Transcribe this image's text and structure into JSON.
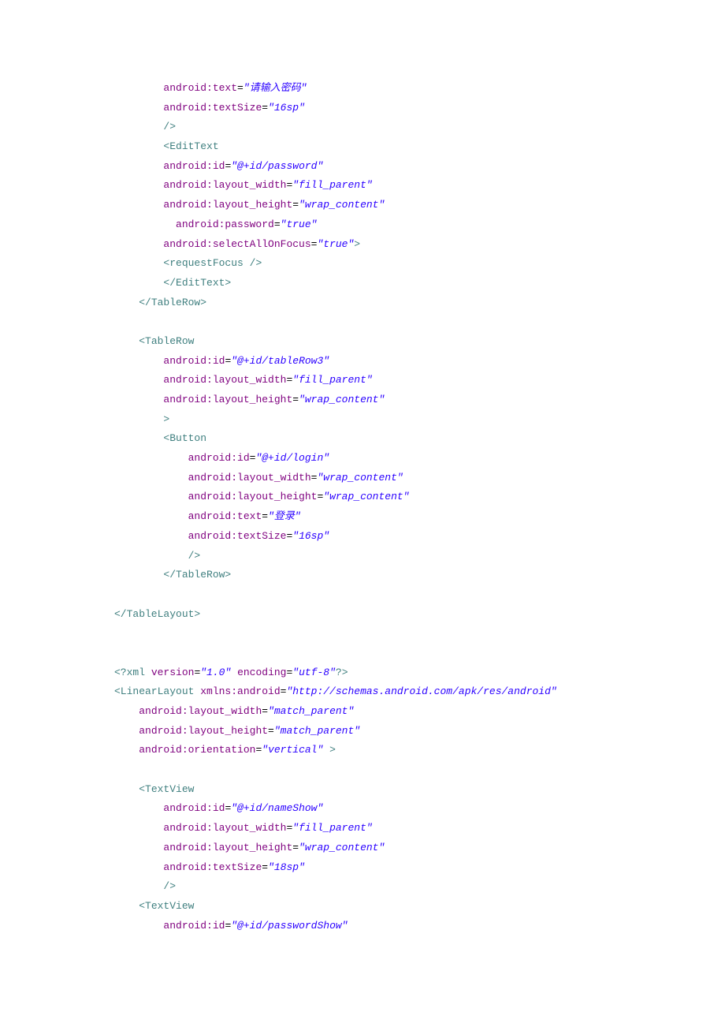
{
  "code": [
    {
      "indent": 2,
      "seg": [
        {
          "t": "attr",
          "v": "android:text"
        },
        {
          "t": "plain",
          "v": "="
        },
        {
          "t": "str",
          "v": "\"请输入密码\""
        }
      ]
    },
    {
      "indent": 2,
      "seg": [
        {
          "t": "attr",
          "v": "android:textSize"
        },
        {
          "t": "plain",
          "v": "="
        },
        {
          "t": "str",
          "v": "\"16sp\""
        }
      ]
    },
    {
      "indent": 2,
      "seg": [
        {
          "t": "tag",
          "v": "/>"
        }
      ]
    },
    {
      "indent": 2,
      "seg": [
        {
          "t": "tag",
          "v": "<EditText"
        }
      ]
    },
    {
      "indent": 2,
      "seg": [
        {
          "t": "attr",
          "v": "android:id"
        },
        {
          "t": "plain",
          "v": "="
        },
        {
          "t": "str",
          "v": "\"@+id/password\""
        }
      ]
    },
    {
      "indent": 2,
      "seg": [
        {
          "t": "attr",
          "v": "android:layout_width"
        },
        {
          "t": "plain",
          "v": "="
        },
        {
          "t": "str",
          "v": "\"fill_parent\""
        }
      ]
    },
    {
      "indent": 2,
      "seg": [
        {
          "t": "attr",
          "v": "android:layout_height"
        },
        {
          "t": "plain",
          "v": "="
        },
        {
          "t": "str",
          "v": "\"wrap_content\""
        }
      ]
    },
    {
      "indent": 2,
      "seg": [
        {
          "t": "plain",
          "v": "  "
        },
        {
          "t": "attr",
          "v": "android:password"
        },
        {
          "t": "plain",
          "v": "="
        },
        {
          "t": "str",
          "v": "\"true\""
        }
      ]
    },
    {
      "indent": 2,
      "seg": [
        {
          "t": "attr",
          "v": "android:selectAllOnFocus"
        },
        {
          "t": "plain",
          "v": "="
        },
        {
          "t": "str",
          "v": "\"true\""
        },
        {
          "t": "tag",
          "v": ">"
        }
      ]
    },
    {
      "indent": 2,
      "seg": [
        {
          "t": "tag",
          "v": "<requestFocus />"
        }
      ]
    },
    {
      "indent": 2,
      "seg": [
        {
          "t": "tag",
          "v": "</EditText>"
        }
      ]
    },
    {
      "indent": 1,
      "seg": [
        {
          "t": "tag",
          "v": "</TableRow>"
        }
      ]
    },
    {
      "indent": 0,
      "seg": [
        {
          "t": "plain",
          "v": ""
        }
      ]
    },
    {
      "indent": 1,
      "seg": [
        {
          "t": "tag",
          "v": "<TableRow"
        }
      ]
    },
    {
      "indent": 2,
      "seg": [
        {
          "t": "attr",
          "v": "android:id"
        },
        {
          "t": "plain",
          "v": "="
        },
        {
          "t": "str",
          "v": "\"@+id/tableRow3\""
        }
      ]
    },
    {
      "indent": 2,
      "seg": [
        {
          "t": "attr",
          "v": "android:layout_width"
        },
        {
          "t": "plain",
          "v": "="
        },
        {
          "t": "str",
          "v": "\"fill_parent\""
        }
      ]
    },
    {
      "indent": 2,
      "seg": [
        {
          "t": "attr",
          "v": "android:layout_height"
        },
        {
          "t": "plain",
          "v": "="
        },
        {
          "t": "str",
          "v": "\"wrap_content\""
        }
      ]
    },
    {
      "indent": 2,
      "seg": [
        {
          "t": "tag",
          "v": ">"
        }
      ]
    },
    {
      "indent": 2,
      "seg": [
        {
          "t": "tag",
          "v": "<Button"
        }
      ]
    },
    {
      "indent": 3,
      "seg": [
        {
          "t": "attr",
          "v": "android:id"
        },
        {
          "t": "plain",
          "v": "="
        },
        {
          "t": "str",
          "v": "\"@+id/login\""
        }
      ]
    },
    {
      "indent": 3,
      "seg": [
        {
          "t": "attr",
          "v": "android:layout_width"
        },
        {
          "t": "plain",
          "v": "="
        },
        {
          "t": "str",
          "v": "\"wrap_content\""
        }
      ]
    },
    {
      "indent": 3,
      "seg": [
        {
          "t": "attr",
          "v": "android:layout_height"
        },
        {
          "t": "plain",
          "v": "="
        },
        {
          "t": "str",
          "v": "\"wrap_content\""
        }
      ]
    },
    {
      "indent": 3,
      "seg": [
        {
          "t": "attr",
          "v": "android:text"
        },
        {
          "t": "plain",
          "v": "="
        },
        {
          "t": "str",
          "v": "\"登录\""
        }
      ]
    },
    {
      "indent": 3,
      "seg": [
        {
          "t": "attr",
          "v": "android:textSize"
        },
        {
          "t": "plain",
          "v": "="
        },
        {
          "t": "str",
          "v": "\"16sp\""
        }
      ]
    },
    {
      "indent": 3,
      "seg": [
        {
          "t": "tag",
          "v": "/>"
        }
      ]
    },
    {
      "indent": 2,
      "seg": [
        {
          "t": "tag",
          "v": "</TableRow>"
        }
      ]
    },
    {
      "indent": 0,
      "seg": [
        {
          "t": "plain",
          "v": ""
        }
      ]
    },
    {
      "indent": 0,
      "seg": [
        {
          "t": "tag",
          "v": "</TableLayout>"
        }
      ]
    },
    {
      "indent": 0,
      "seg": [
        {
          "t": "plain",
          "v": ""
        }
      ]
    },
    {
      "indent": 0,
      "seg": [
        {
          "t": "plain",
          "v": ""
        }
      ]
    },
    {
      "indent": 0,
      "seg": [
        {
          "t": "tag",
          "v": "<?"
        },
        {
          "t": "tag",
          "v": "xml "
        },
        {
          "t": "attr",
          "v": "version"
        },
        {
          "t": "plain",
          "v": "="
        },
        {
          "t": "str",
          "v": "\"1.0\" "
        },
        {
          "t": "attr",
          "v": "encoding"
        },
        {
          "t": "plain",
          "v": "="
        },
        {
          "t": "str",
          "v": "\"utf-8\""
        },
        {
          "t": "tag",
          "v": "?>"
        }
      ]
    },
    {
      "indent": 0,
      "seg": [
        {
          "t": "tag",
          "v": "<LinearLayout "
        },
        {
          "t": "attr",
          "v": "xmlns:android"
        },
        {
          "t": "plain",
          "v": "="
        },
        {
          "t": "str",
          "v": "\"http://schemas.android.com/apk/res/android\""
        }
      ]
    },
    {
      "indent": 1,
      "seg": [
        {
          "t": "attr",
          "v": "android:layout_width"
        },
        {
          "t": "plain",
          "v": "="
        },
        {
          "t": "str",
          "v": "\"match_parent\""
        }
      ]
    },
    {
      "indent": 1,
      "seg": [
        {
          "t": "attr",
          "v": "android:layout_height"
        },
        {
          "t": "plain",
          "v": "="
        },
        {
          "t": "str",
          "v": "\"match_parent\""
        }
      ]
    },
    {
      "indent": 1,
      "seg": [
        {
          "t": "attr",
          "v": "android:orientation"
        },
        {
          "t": "plain",
          "v": "="
        },
        {
          "t": "str",
          "v": "\"vertical\" "
        },
        {
          "t": "tag",
          "v": ">"
        }
      ]
    },
    {
      "indent": 0,
      "seg": [
        {
          "t": "plain",
          "v": ""
        }
      ]
    },
    {
      "indent": 1,
      "seg": [
        {
          "t": "tag",
          "v": "<TextView"
        }
      ]
    },
    {
      "indent": 2,
      "seg": [
        {
          "t": "attr",
          "v": "android:id"
        },
        {
          "t": "plain",
          "v": "="
        },
        {
          "t": "str",
          "v": "\"@+id/nameShow\""
        }
      ]
    },
    {
      "indent": 2,
      "seg": [
        {
          "t": "attr",
          "v": "android:layout_width"
        },
        {
          "t": "plain",
          "v": "="
        },
        {
          "t": "str",
          "v": "\"fill_parent\""
        }
      ]
    },
    {
      "indent": 2,
      "seg": [
        {
          "t": "attr",
          "v": "android:layout_height"
        },
        {
          "t": "plain",
          "v": "="
        },
        {
          "t": "str",
          "v": "\"wrap_content\""
        }
      ]
    },
    {
      "indent": 2,
      "seg": [
        {
          "t": "attr",
          "v": "android:textSize"
        },
        {
          "t": "plain",
          "v": "="
        },
        {
          "t": "str",
          "v": "\"18sp\""
        }
      ]
    },
    {
      "indent": 2,
      "seg": [
        {
          "t": "tag",
          "v": "/>"
        }
      ]
    },
    {
      "indent": 1,
      "seg": [
        {
          "t": "tag",
          "v": "<TextView"
        }
      ]
    },
    {
      "indent": 2,
      "seg": [
        {
          "t": "attr",
          "v": "android:id"
        },
        {
          "t": "plain",
          "v": "="
        },
        {
          "t": "str",
          "v": "\"@+id/passwordShow\""
        }
      ]
    }
  ],
  "indentUnit": "    "
}
